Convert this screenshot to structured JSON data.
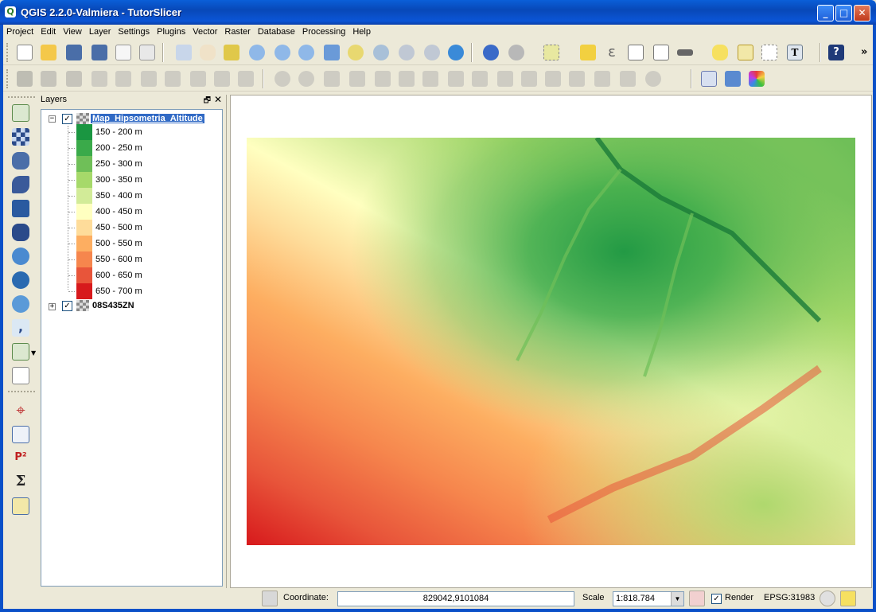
{
  "window": {
    "title": "QGIS 2.2.0-Valmiera - TutorSlicer",
    "app_icon": "Q"
  },
  "menu": [
    "Project",
    "Edit",
    "View",
    "Layer",
    "Settings",
    "Plugins",
    "Vector",
    "Raster",
    "Database",
    "Processing",
    "Help"
  ],
  "toolbar_overflow": "»",
  "layers_panel": {
    "title": "Layers",
    "layers": [
      {
        "name": "Map_Hipsometria_Altitude",
        "checked": true,
        "expanded": true,
        "selected": true,
        "legend": [
          {
            "label": "150 - 200 m",
            "color": "#1a9641"
          },
          {
            "label": "200 - 250 m",
            "color": "#3aaa4a"
          },
          {
            "label": "250 - 300 m",
            "color": "#6fbf58"
          },
          {
            "label": "300 - 350 m",
            "color": "#a6d96a"
          },
          {
            "label": "350 - 400 m",
            "color": "#d2eb98"
          },
          {
            "label": "400 - 450 m",
            "color": "#ffffc0"
          },
          {
            "label": "450 - 500 m",
            "color": "#fedc9a"
          },
          {
            "label": "500 - 550 m",
            "color": "#fdae61"
          },
          {
            "label": "550 - 600 m",
            "color": "#f6864d"
          },
          {
            "label": "600 - 650 m",
            "color": "#e8553a"
          },
          {
            "label": "650 - 700 m",
            "color": "#d7191c"
          }
        ]
      },
      {
        "name": "08S435ZN",
        "checked": true,
        "expanded": false,
        "selected": false
      }
    ]
  },
  "statusbar": {
    "coordinate_label": "Coordinate:",
    "coordinate_value": "829042,9101084",
    "scale_label": "Scale",
    "scale_value": "1:818.784",
    "render_label": "Render",
    "render_checked": true,
    "crs": "EPSG:31983"
  }
}
